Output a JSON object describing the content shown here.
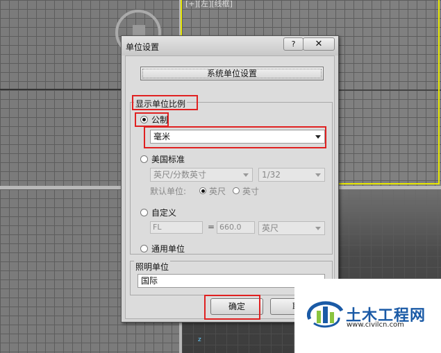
{
  "viewport": {
    "label": "[+][左][线框]",
    "axis_z": "z"
  },
  "dialog": {
    "title": "单位设置",
    "help_glyph": "?",
    "close_glyph": "✕",
    "system_units_button": "系统单位设置",
    "display_group": {
      "title": "显示单位比例",
      "metric": {
        "label": "公制",
        "selected": "毫米",
        "checked": true
      },
      "us_standard": {
        "label": "美国标准",
        "unit_select": "英尺/分数英寸",
        "fraction_select": "1/32",
        "default_unit_label": "默认单位:",
        "opt_feet": "英尺",
        "opt_inches": "英寸"
      },
      "custom": {
        "label": "自定义",
        "name_value": "FL",
        "equals": "=",
        "amount_value": "660.0",
        "unit_select": "英尺"
      },
      "generic": {
        "label": "通用单位"
      }
    },
    "lighting_group": {
      "title": "照明单位",
      "selected": "国际"
    },
    "ok_button": "确定",
    "cancel_button": "取"
  },
  "watermark": {
    "cn_text": "土木工程网",
    "url": "www.civilcn.com"
  },
  "colors": {
    "highlight": "#e02020",
    "active_viewport": "#e8e800",
    "brand_blue": "#1a5aa6"
  }
}
